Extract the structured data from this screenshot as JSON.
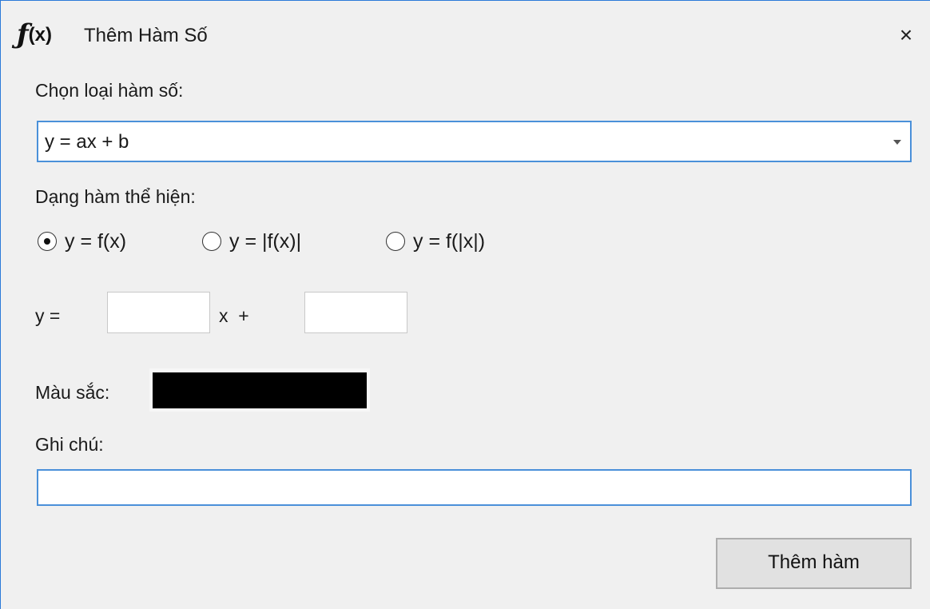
{
  "window": {
    "title": "Thêm Hàm Số",
    "icon": "function-fx-icon",
    "close_glyph": "×"
  },
  "function_type": {
    "label": "Chọn loại hàm số:",
    "selected": "y = ax + b"
  },
  "display_form": {
    "label": "Dạng hàm thể hiện:",
    "options": [
      {
        "label": "y = f(x)",
        "checked": true
      },
      {
        "label": "y = |f(x)|",
        "checked": false
      },
      {
        "label": "y = f(|x|)",
        "checked": false
      }
    ]
  },
  "equation": {
    "prefix": "y =",
    "coef_a": "",
    "middle": "x  +",
    "coef_b": ""
  },
  "color": {
    "label": "Màu sắc:",
    "value": "#000000"
  },
  "note": {
    "label": "Ghi chú:",
    "value": ""
  },
  "actions": {
    "add_label": "Thêm hàm"
  },
  "theme": {
    "accent": "#4a90d9",
    "window_border": "#2b79d8",
    "background": "#f0f0f0"
  }
}
